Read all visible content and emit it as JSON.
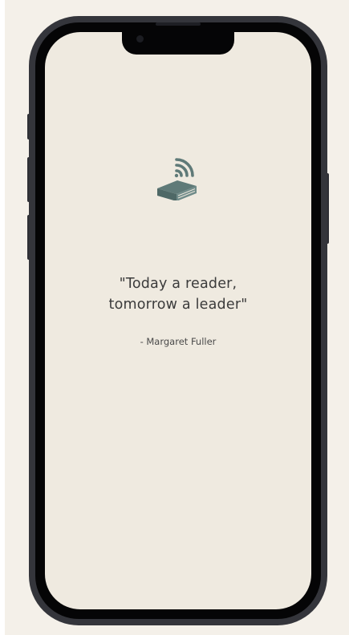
{
  "app": {
    "logo_icon": "book-stack-with-wifi-signal-icon",
    "accent_color": "#5f7a78"
  },
  "splash": {
    "quote_line_1": "\"Today a reader,",
    "quote_line_2": "tomorrow a leader\"",
    "author": "- Margaret Fuller"
  }
}
